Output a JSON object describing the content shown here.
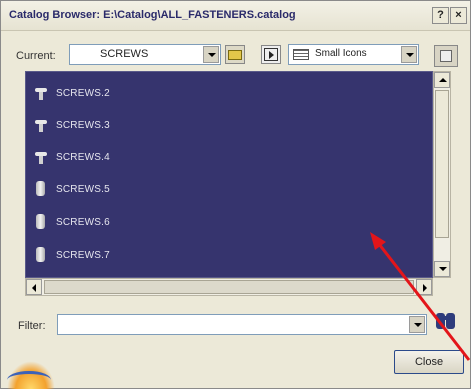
{
  "window": {
    "title": "Catalog Browser: E:\\Catalog\\ALL_FASTENERS.catalog",
    "help_label": "?",
    "close_glyph": "×"
  },
  "toolbar": {
    "current_label": "Current:",
    "current_value": "SCREWS",
    "view_mode_value": "Small Icons"
  },
  "list": {
    "items": [
      {
        "label": "SCREWS.2",
        "icon": "flat-screw-icon"
      },
      {
        "label": "SCREWS.3",
        "icon": "flat-screw-icon"
      },
      {
        "label": "SCREWS.4",
        "icon": "flat-screw-icon"
      },
      {
        "label": "SCREWS.5",
        "icon": "cylinder-screw-icon"
      },
      {
        "label": "SCREWS.6",
        "icon": "cylinder-screw-icon"
      },
      {
        "label": "SCREWS.7",
        "icon": "cylinder-screw-icon"
      }
    ]
  },
  "filter": {
    "label": "Filter:",
    "value": ""
  },
  "footer": {
    "close_label": "Close"
  },
  "colors": {
    "list_background": "#36346e",
    "dialog_background": "#ece9d8",
    "annotation_arrow": "#e3151a"
  }
}
